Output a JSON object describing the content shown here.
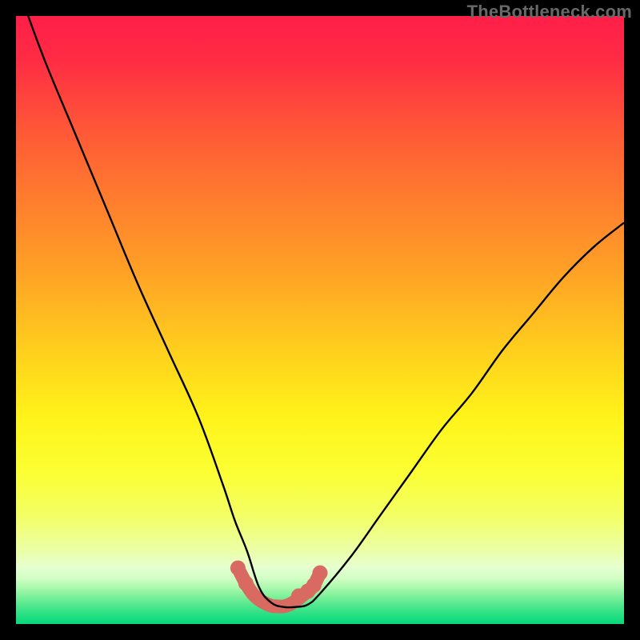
{
  "watermark": "TheBottleneck.com",
  "chart_data": {
    "type": "line",
    "title": "",
    "xlabel": "",
    "ylabel": "",
    "xlim": [
      0,
      100
    ],
    "ylim": [
      0,
      100
    ],
    "series": [
      {
        "name": "curve",
        "x": [
          2,
          5,
          10,
          15,
          20,
          25,
          30,
          34,
          36,
          38,
          40,
          42,
          44,
          46,
          48,
          50,
          55,
          60,
          65,
          70,
          75,
          80,
          85,
          90,
          95,
          100
        ],
        "y": [
          100,
          92,
          80,
          68,
          56,
          45,
          34,
          23,
          17,
          12,
          6,
          3.5,
          2.8,
          2.8,
          3.2,
          5,
          11,
          18,
          25,
          32,
          38,
          45,
          51,
          57,
          62,
          66
        ]
      }
    ],
    "markers": {
      "name": "basin-dots",
      "x": [
        36.5,
        37.8,
        46.5,
        48,
        49,
        50
      ],
      "y": [
        9.2,
        6.7,
        4.6,
        5.4,
        6.4,
        8.4
      ]
    },
    "basin_stroke": {
      "name": "basin-stroke",
      "x": [
        36.5,
        37.8,
        39,
        40,
        41,
        42,
        43,
        44,
        45,
        46,
        47,
        48,
        49,
        50
      ],
      "y": [
        9.2,
        6.7,
        4.9,
        4.0,
        3.4,
        3.0,
        2.9,
        2.9,
        3.2,
        3.8,
        4.6,
        5.4,
        6.4,
        8.4
      ]
    },
    "gradient_stops": [
      {
        "offset": 0.0,
        "color": "#ff1f49"
      },
      {
        "offset": 0.07,
        "color": "#ff2b44"
      },
      {
        "offset": 0.18,
        "color": "#ff5538"
      },
      {
        "offset": 0.3,
        "color": "#ff7c2e"
      },
      {
        "offset": 0.42,
        "color": "#ffa126"
      },
      {
        "offset": 0.55,
        "color": "#ffcf1d"
      },
      {
        "offset": 0.66,
        "color": "#fff31a"
      },
      {
        "offset": 0.75,
        "color": "#fbff33"
      },
      {
        "offset": 0.82,
        "color": "#f3ff63"
      },
      {
        "offset": 0.875,
        "color": "#ecffa2"
      },
      {
        "offset": 0.907,
        "color": "#e6ffd0"
      },
      {
        "offset": 0.925,
        "color": "#d2ffc6"
      },
      {
        "offset": 0.94,
        "color": "#aaf9ad"
      },
      {
        "offset": 0.955,
        "color": "#7df09a"
      },
      {
        "offset": 0.97,
        "color": "#4fe78d"
      },
      {
        "offset": 0.985,
        "color": "#27df83"
      },
      {
        "offset": 1.0,
        "color": "#05d87b"
      }
    ],
    "colors": {
      "curve": "#000000",
      "basin": "#d86a62"
    }
  }
}
